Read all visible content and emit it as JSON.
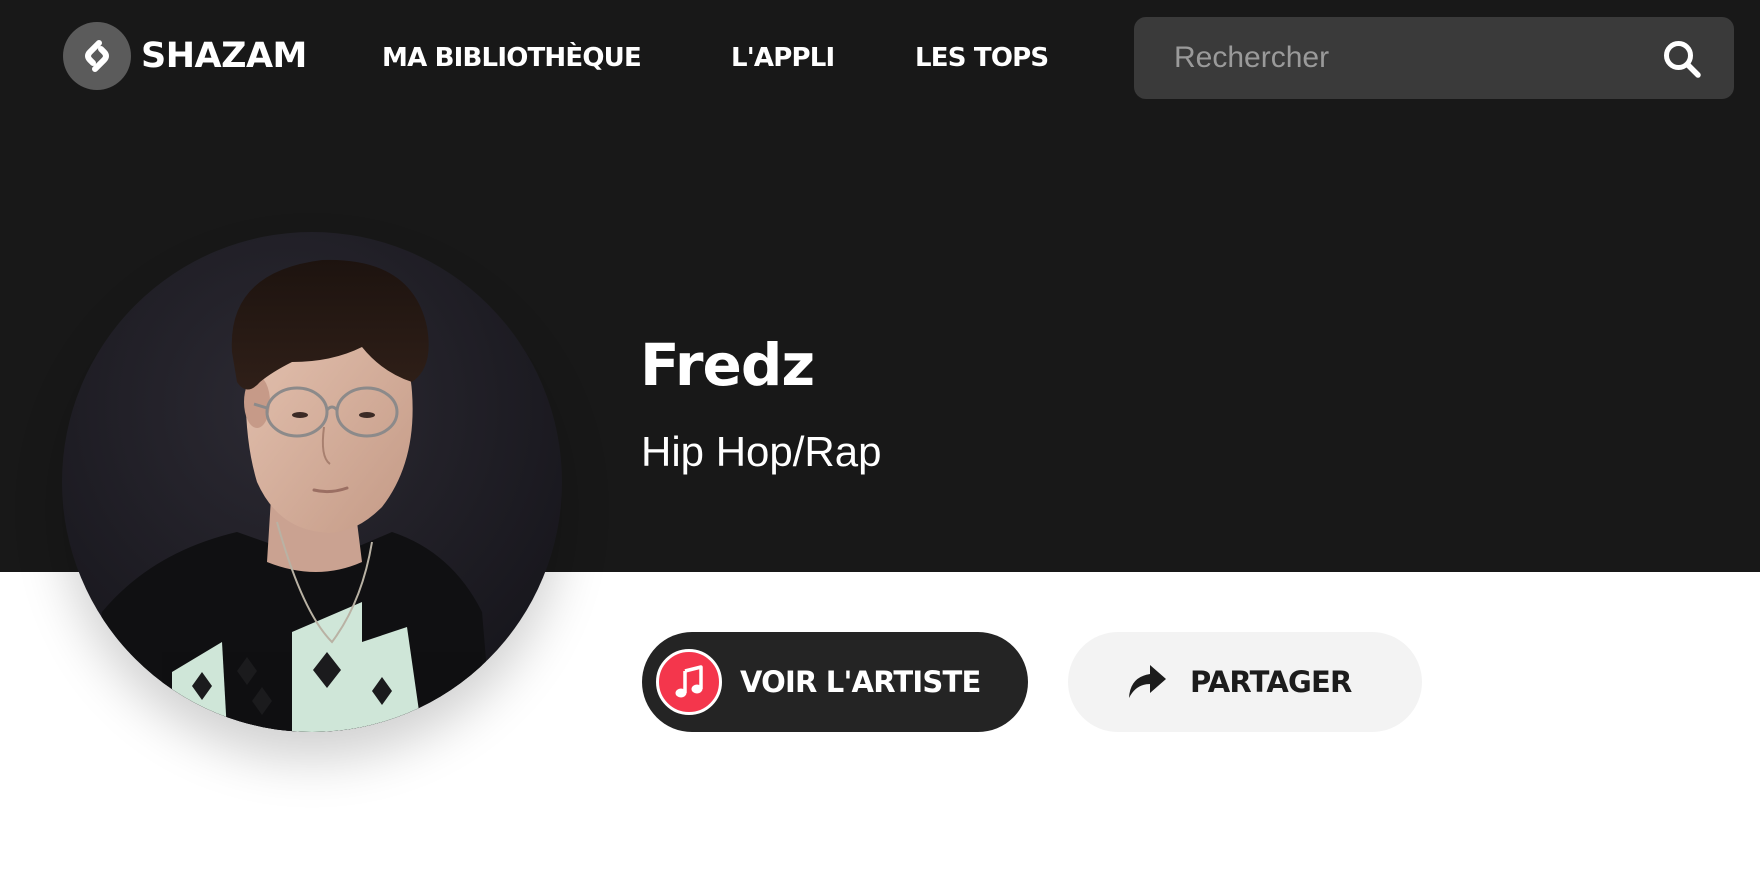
{
  "header": {
    "logo_text": "SHAZAM",
    "nav": [
      {
        "label": "MA BIBLIOTHÈQUE"
      },
      {
        "label": "L'APPLI"
      },
      {
        "label": "LES TOPS"
      }
    ],
    "search": {
      "placeholder": "Rechercher",
      "value": "",
      "icon": "search-icon"
    }
  },
  "artist": {
    "name": "Fredz",
    "genre": "Hip Hop/Rap",
    "photo": "artist-photo"
  },
  "actions": {
    "view_artist": {
      "label": "VOIR L'ARTISTE",
      "icon": "apple-music-icon"
    },
    "share": {
      "label": "PARTAGER",
      "icon": "share-arrow-icon"
    }
  },
  "colors": {
    "header_bg": "#181818",
    "search_bg": "#3a3a3a",
    "logo_circle": "#5b5b5b",
    "apple_music_red": "#f4364c",
    "artist_button_bg": "#242424",
    "share_button_bg": "#f3f3f3",
    "page_bg": "#ffffff"
  }
}
